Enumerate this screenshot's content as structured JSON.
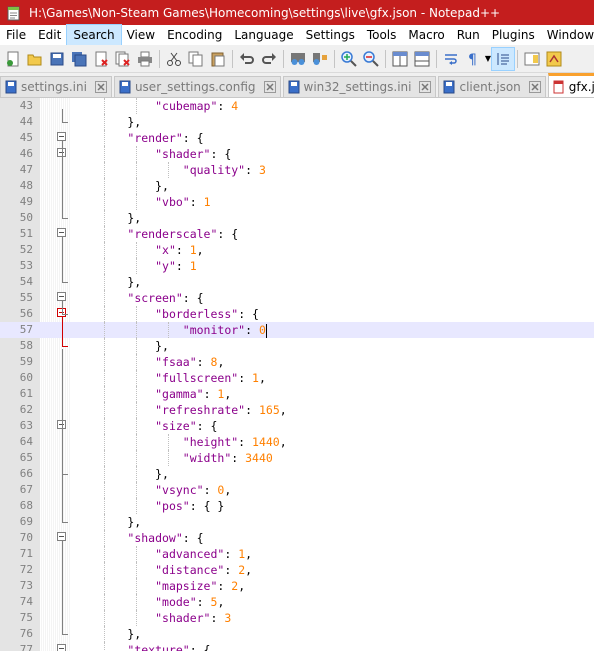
{
  "window": {
    "title": "H:\\Games\\Non-Steam Games\\Homecoming\\settings\\live\\gfx.json - Notepad++"
  },
  "menu": [
    "File",
    "Edit",
    "Search",
    "View",
    "Encoding",
    "Language",
    "Settings",
    "Tools",
    "Macro",
    "Run",
    "Plugins",
    "Window",
    "?"
  ],
  "toolbar": {
    "buttons": [
      "new-file-icon",
      "open-file-icon",
      "save-icon",
      "save-all-icon",
      "close-icon",
      "close-all-icon",
      "print-icon",
      "cut-icon",
      "copy-icon",
      "paste-icon",
      "undo-icon",
      "redo-icon",
      "find-icon",
      "replace-icon",
      "zoom-in-icon",
      "zoom-out-icon",
      "sync-vertical-icon",
      "sync-horizontal-icon",
      "word-wrap-icon",
      "show-all-chars-icon",
      "indent-guide-icon",
      "doc-map-icon",
      "function-list-icon"
    ]
  },
  "tabs": [
    {
      "label": "settings.ini",
      "active": false
    },
    {
      "label": "user_settings.config",
      "active": false
    },
    {
      "label": "win32_settings.ini",
      "active": false
    },
    {
      "label": "client.json",
      "active": false
    },
    {
      "label": "gfx.json",
      "active": true
    }
  ],
  "editor": {
    "lines": [
      {
        "n": "43",
        "t": "            \"cubemap\": 4"
      },
      {
        "n": "44",
        "t": "        },"
      },
      {
        "n": "45",
        "t": "        \"render\": {"
      },
      {
        "n": "46",
        "t": "            \"shader\": {"
      },
      {
        "n": "47",
        "t": "                \"quality\": 3"
      },
      {
        "n": "48",
        "t": "            },"
      },
      {
        "n": "49",
        "t": "            \"vbo\": 1"
      },
      {
        "n": "50",
        "t": "        },"
      },
      {
        "n": "51",
        "t": "        \"renderscale\": {"
      },
      {
        "n": "52",
        "t": "            \"x\": 1,"
      },
      {
        "n": "53",
        "t": "            \"y\": 1"
      },
      {
        "n": "54",
        "t": "        },"
      },
      {
        "n": "55",
        "t": "        \"screen\": {"
      },
      {
        "n": "56",
        "t": "            \"borderless\": {"
      },
      {
        "n": "57",
        "t": "                \"monitor\": 0"
      },
      {
        "n": "58",
        "t": "            },"
      },
      {
        "n": "59",
        "t": "            \"fsaa\": 8,"
      },
      {
        "n": "60",
        "t": "            \"fullscreen\": 1,"
      },
      {
        "n": "61",
        "t": "            \"gamma\": 1,"
      },
      {
        "n": "62",
        "t": "            \"refreshrate\": 165,"
      },
      {
        "n": "63",
        "t": "            \"size\": {"
      },
      {
        "n": "64",
        "t": "                \"height\": 1440,"
      },
      {
        "n": "65",
        "t": "                \"width\": 3440"
      },
      {
        "n": "66",
        "t": "            },"
      },
      {
        "n": "67",
        "t": "            \"vsync\": 0,"
      },
      {
        "n": "68",
        "t": "            \"pos\": { }"
      },
      {
        "n": "69",
        "t": "        },"
      },
      {
        "n": "70",
        "t": "        \"shadow\": {"
      },
      {
        "n": "71",
        "t": "            \"advanced\": 1,"
      },
      {
        "n": "72",
        "t": "            \"distance\": 2,"
      },
      {
        "n": "73",
        "t": "            \"mapsize\": 2,"
      },
      {
        "n": "74",
        "t": "            \"mode\": 5,"
      },
      {
        "n": "75",
        "t": "            \"shader\": 3"
      },
      {
        "n": "76",
        "t": "        },"
      },
      {
        "n": "77",
        "t": "        \"texture\": {"
      }
    ],
    "current_line": "57",
    "fold_starts": [
      "45",
      "46",
      "51",
      "55",
      "56",
      "63",
      "70",
      "77"
    ],
    "colors": {
      "key": "#8b008b",
      "number": "#ff8000",
      "current_line": "#e8e8ff",
      "title_bar": "#c41e1e",
      "active_tab_accent": "#f9a12e"
    }
  }
}
